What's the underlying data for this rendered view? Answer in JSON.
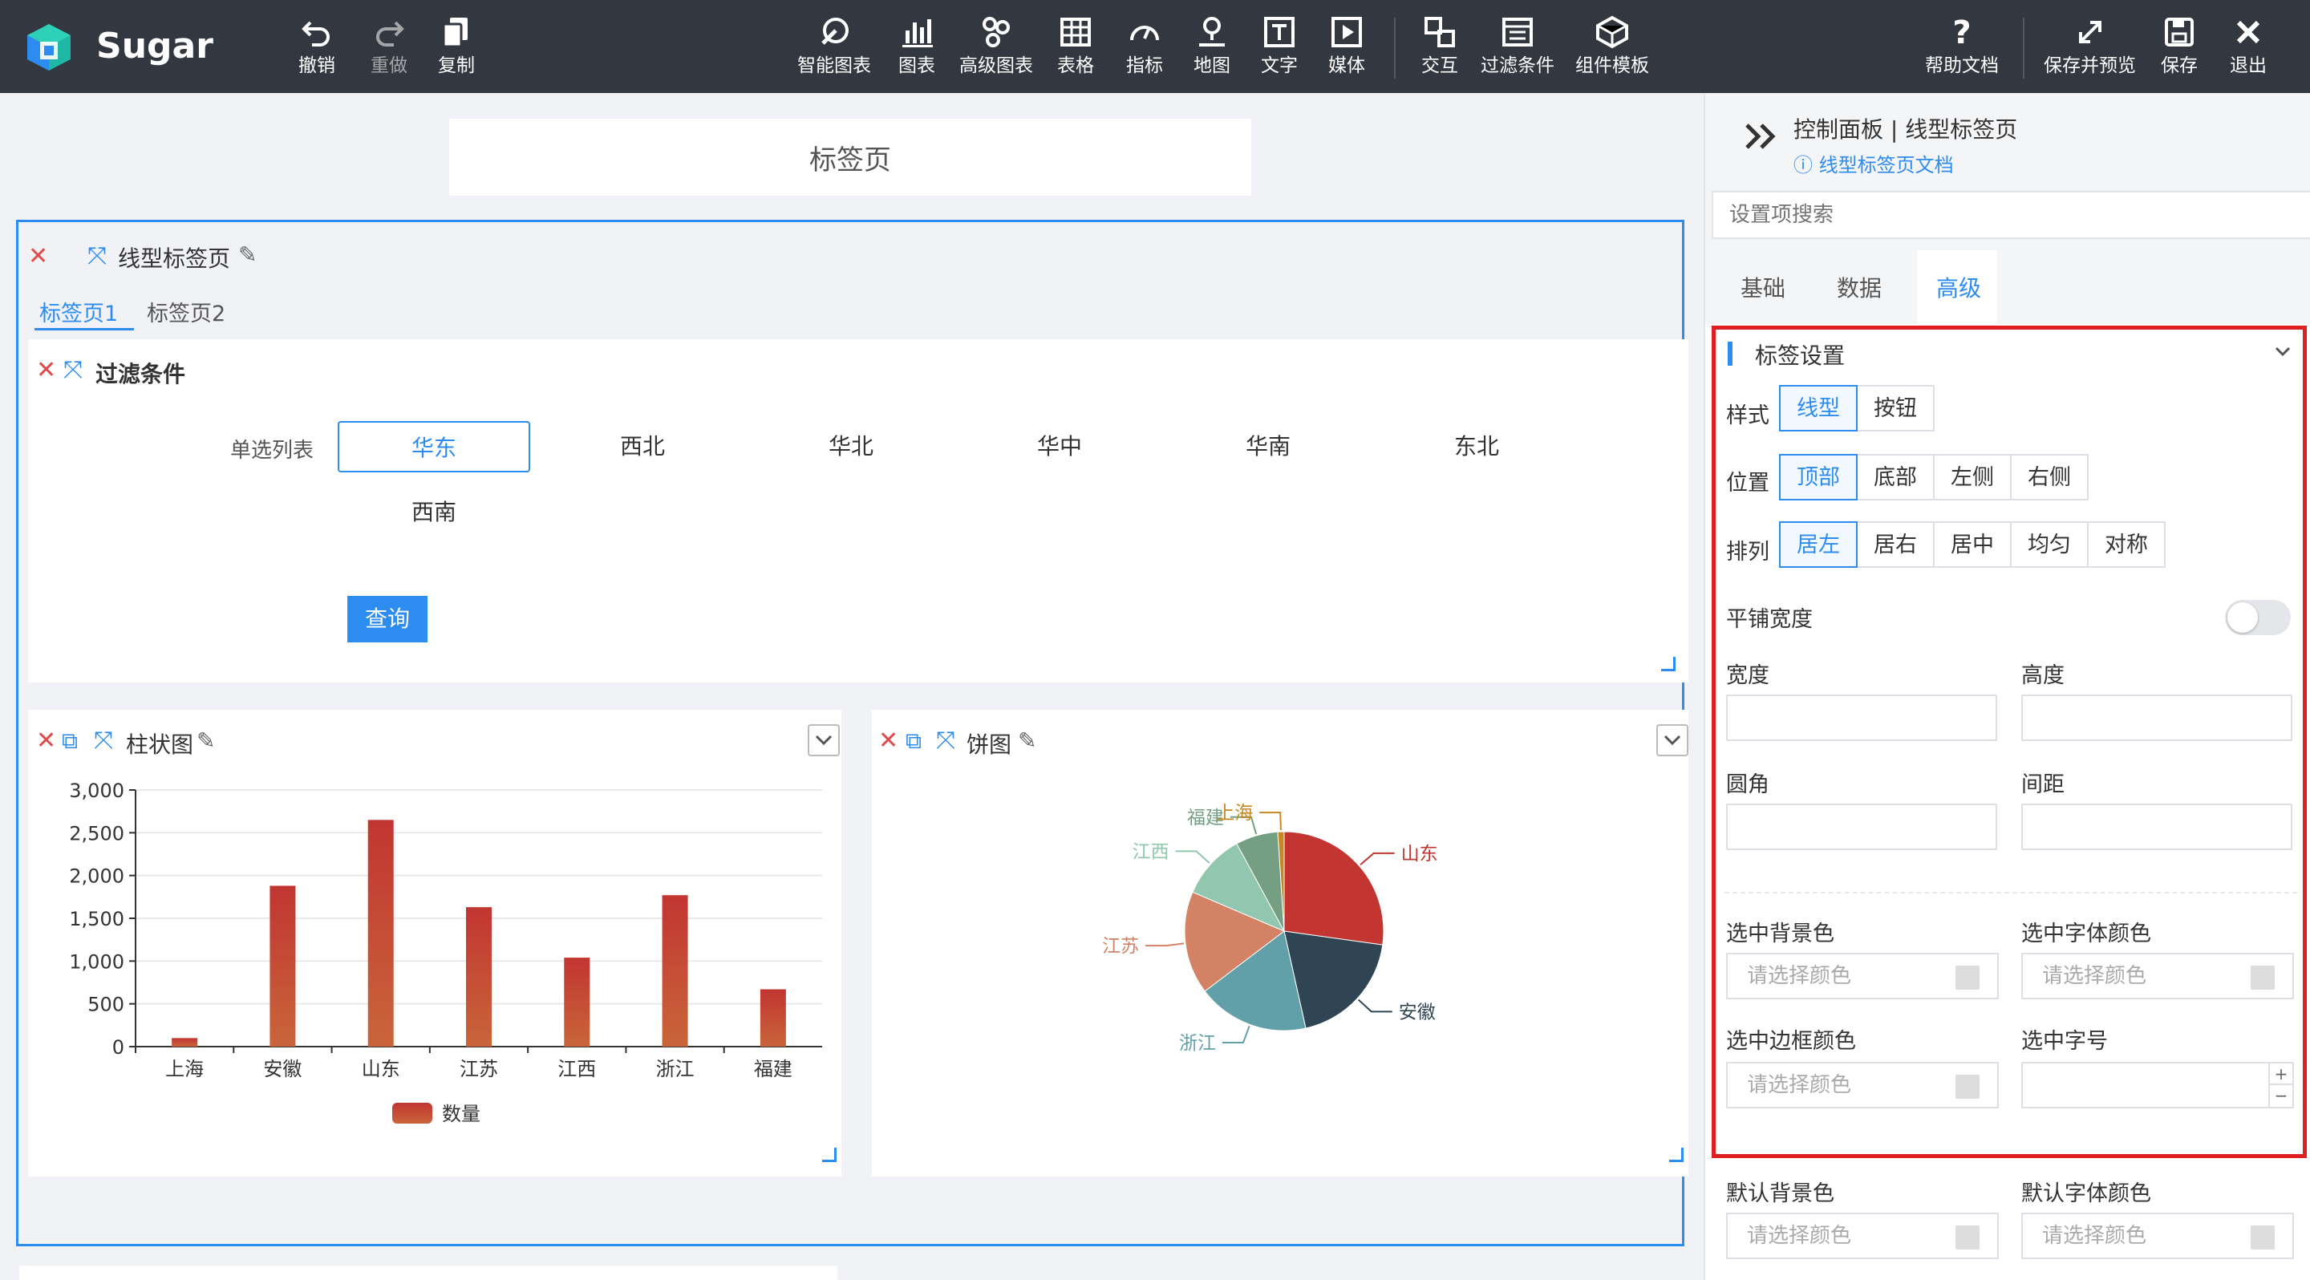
{
  "app": {
    "name": "Sugar"
  },
  "toolbar": {
    "undo": "撤销",
    "redo": "重做",
    "copy": "复制",
    "items": [
      "智能图表",
      "图表",
      "高级图表",
      "表格",
      "指标",
      "地图",
      "文字",
      "媒体",
      "交互",
      "过滤条件",
      "组件模板"
    ],
    "help": "帮助文档",
    "save_preview": "保存并预览",
    "save": "保存",
    "exit": "退出"
  },
  "canvas": {
    "tab_header": "标签页",
    "tab_widget_title": "线型标签页",
    "tabs": [
      "标签页1",
      "标签页2"
    ],
    "filter": {
      "title": "过滤条件",
      "label": "单选列表",
      "options": [
        "华东",
        "西北",
        "华北",
        "华中",
        "华南",
        "东北",
        "西南"
      ],
      "selected": "华东",
      "query": "查询"
    },
    "bar_title": "柱状图",
    "pie_title": "饼图"
  },
  "chart_data": [
    {
      "type": "bar",
      "categories": [
        "上海",
        "安徽",
        "山东",
        "江苏",
        "江西",
        "浙江",
        "福建"
      ],
      "series": [
        {
          "name": "数量",
          "values": [
            100,
            1880,
            2650,
            1630,
            1040,
            1770,
            670
          ]
        }
      ],
      "ylim": [
        0,
        3000
      ],
      "yticks": [
        "0",
        "500",
        "1,000",
        "1,500",
        "2,000",
        "2,500",
        "3,000"
      ],
      "legend": "bottom",
      "color": "#c0392b"
    },
    {
      "type": "pie",
      "labels": [
        "山东",
        "安徽",
        "浙江",
        "江苏",
        "江西",
        "福建",
        "上海"
      ],
      "values": [
        2650,
        1880,
        1770,
        1630,
        1040,
        670,
        100
      ],
      "colors": [
        "#c23531",
        "#2f4554",
        "#61a0a8",
        "#d48265",
        "#91c7ae",
        "#749f83",
        "#ca8622"
      ]
    }
  ],
  "panel": {
    "breadcrumb": "控制面板 | 线型标签页",
    "doc_link": "线型标签页文档",
    "search_placeholder": "设置项搜索",
    "tabs": [
      "基础",
      "数据",
      "高级"
    ],
    "active_tab": "高级",
    "section_title": "标签设置",
    "style_label": "样式",
    "style_options": [
      "线型",
      "按钮"
    ],
    "position_label": "位置",
    "position_options": [
      "顶部",
      "底部",
      "左侧",
      "右侧"
    ],
    "align_label": "排列",
    "align_options": [
      "居左",
      "居右",
      "居中",
      "均匀",
      "对称"
    ],
    "tile_width": "平铺宽度",
    "width": "宽度",
    "height": "高度",
    "radius": "圆角",
    "spacing": "间距",
    "sel_bg": "选中背景色",
    "sel_font_color": "选中字体颜色",
    "sel_border": "选中边框颜色",
    "sel_font_size": "选中字号",
    "def_bg": "默认背景色",
    "def_font_color": "默认字体颜色",
    "color_placeholder": "请选择颜色"
  },
  "colors": {
    "accent": "#2d8cf0",
    "topbar": "#33373f",
    "highlight": "#e02020"
  }
}
